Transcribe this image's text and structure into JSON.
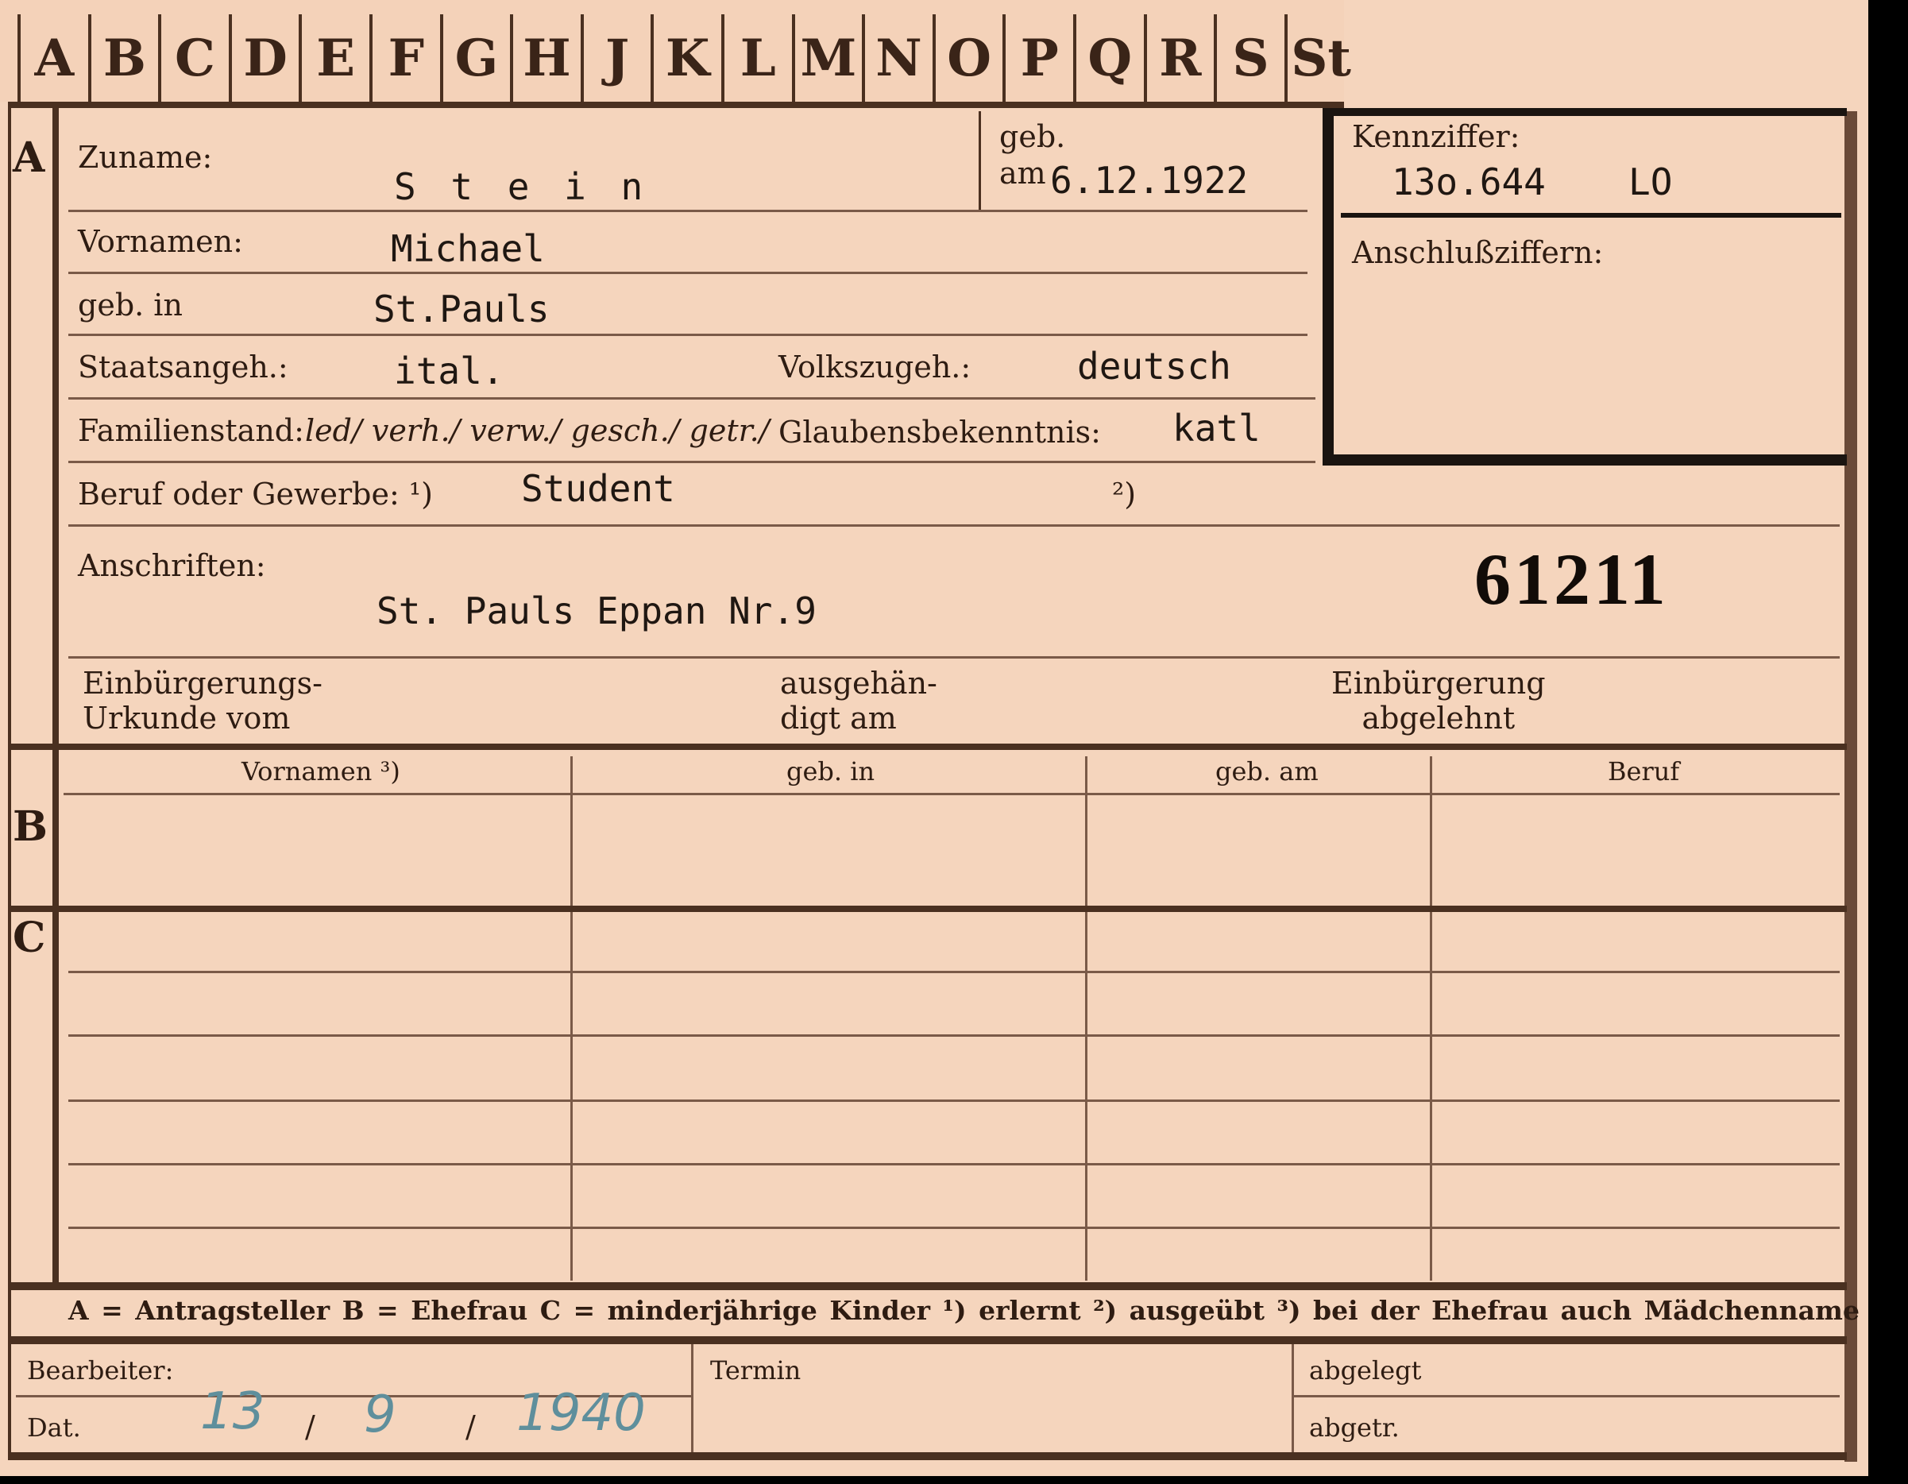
{
  "tabs": [
    "A",
    "B",
    "C",
    "D",
    "E",
    "F",
    "G",
    "H",
    "J",
    "K",
    "L",
    "M",
    "N",
    "O",
    "P",
    "Q",
    "R",
    "S",
    "St"
  ],
  "sections": {
    "a": "A",
    "b": "B",
    "c": "C"
  },
  "labels": {
    "zuname": "Zuname:",
    "geb": "geb.",
    "am": "am",
    "vornamen": "Vornamen:",
    "geb_in": "geb. in",
    "staatsangeh": "Staatsangeh.:",
    "volkszugeh": "Volkszugeh.:",
    "familienstand": "Familienstand:",
    "familienstand_options": "led/ verh./ verw./ gesch./ getr./",
    "glaubensbekenntnis": "Glaubensbekenntnis:",
    "beruf": "Beruf oder Gewerbe: ¹)",
    "beruf_note2": "²)",
    "anschriften": "Anschriften:",
    "einbuergerung_urkunde": "Einbürgerungs-\nUrkunde vom",
    "ausgehaendigt": "ausgehän-\ndigt am",
    "einbuergerung_abgelehnt": "Einbürgerung\nabgelehnt",
    "kennziffer": "Kennziffer:",
    "anschlussziffern": "Anschlußziffern:",
    "table_vornamen": "Vornamen ³)",
    "table_geb_in": "geb. in",
    "table_geb_am": "geb. am",
    "table_beruf": "Beruf",
    "legend": "A = Antragsteller   B = Ehefrau   C = minderjährige Kinder   ¹) erlernt   ²) ausgeübt   ³) bei der Ehefrau auch Mädchenname",
    "bearbeiter": "Bearbeiter:",
    "dat": "Dat.",
    "termin": "Termin",
    "abgelegt": "abgelegt",
    "abgetr": "abgetr."
  },
  "values": {
    "zuname": "S t e i n",
    "geb_am": "6.12.1922",
    "vornamen": "Michael",
    "geb_in": "St.Pauls",
    "staatsangeh": "ital.",
    "volkszugeh": "deutsch",
    "glaube": "katl",
    "beruf": "Student",
    "anschrift": "St. Pauls Eppan Nr.9",
    "number": "61211",
    "kennziffer": "13o.644",
    "kennziffer_suffix": "LO",
    "date_day": "13",
    "date_month": "9",
    "date_year": "1940",
    "date_sep": "/"
  }
}
